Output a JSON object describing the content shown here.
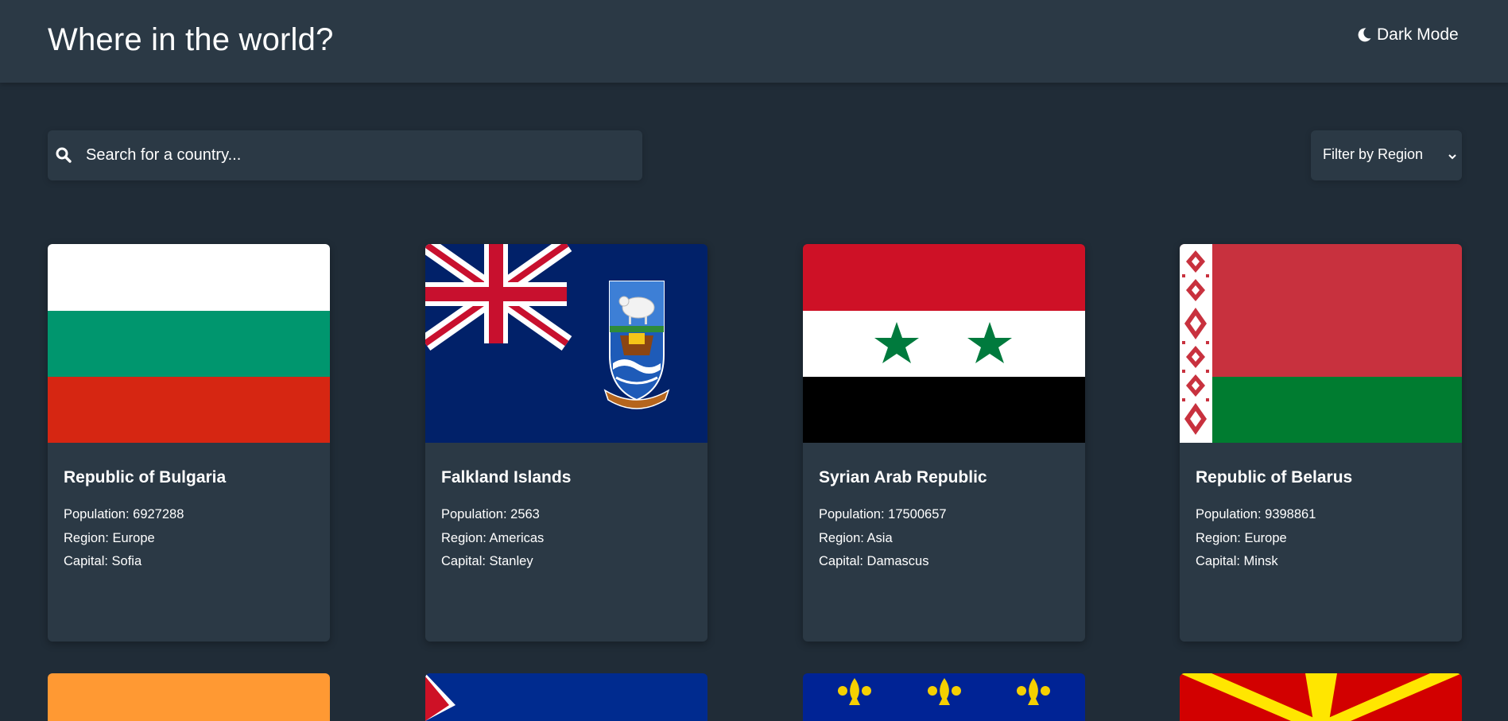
{
  "header": {
    "title": "Where in the world?",
    "theme_toggle_label": "Dark Mode"
  },
  "search": {
    "placeholder": "Search for a country..."
  },
  "filter": {
    "selected": "Filter by Region"
  },
  "labels": {
    "population": "Population: ",
    "region": "Region: ",
    "capital": "Capital: "
  },
  "countries": [
    {
      "name": "Republic of Bulgaria",
      "population": "6927288",
      "region": "Europe",
      "capital": "Sofia",
      "flag": "bulgaria-flag"
    },
    {
      "name": "Falkland Islands",
      "population": "2563",
      "region": "Americas",
      "capital": "Stanley",
      "flag": "falkland-islands-flag"
    },
    {
      "name": "Syrian Arab Republic",
      "population": "17500657",
      "region": "Asia",
      "capital": "Damascus",
      "flag": "syria-flag"
    },
    {
      "name": "Republic of Belarus",
      "population": "9398861",
      "region": "Europe",
      "capital": "Minsk",
      "flag": "belarus-flag"
    }
  ],
  "colors": {
    "background": "#202c37",
    "surface": "#2b3945",
    "text": "#ffffff"
  }
}
